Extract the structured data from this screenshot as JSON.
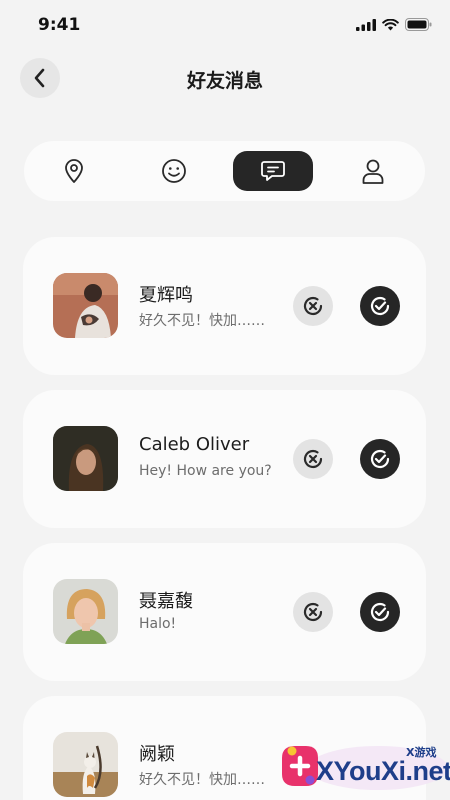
{
  "status_bar": {
    "time": "9:41"
  },
  "header": {
    "title": "好友消息",
    "back_icon": "chevron-left-icon"
  },
  "tabs": [
    {
      "icon": "location-pin-icon",
      "active": false
    },
    {
      "icon": "smiley-icon",
      "active": false
    },
    {
      "icon": "message-icon",
      "active": true
    },
    {
      "icon": "person-icon",
      "active": false
    }
  ],
  "requests": [
    {
      "name": "夏辉鸣",
      "message": "好久不见！快加……"
    },
    {
      "name": "Caleb Oliver",
      "message": "Hey! How are you?"
    },
    {
      "name": "聂嘉馥",
      "message": "Halo!"
    },
    {
      "name": "阙颖",
      "message": "好久不见！快加……"
    }
  ],
  "watermark": {
    "brand": "XYouXi.net",
    "small": "X游戏"
  },
  "colors": {
    "background": "#f3f3f3",
    "card": "#fbfbfb",
    "accent_dark": "#262626",
    "watermark": "#1e3e8a"
  }
}
